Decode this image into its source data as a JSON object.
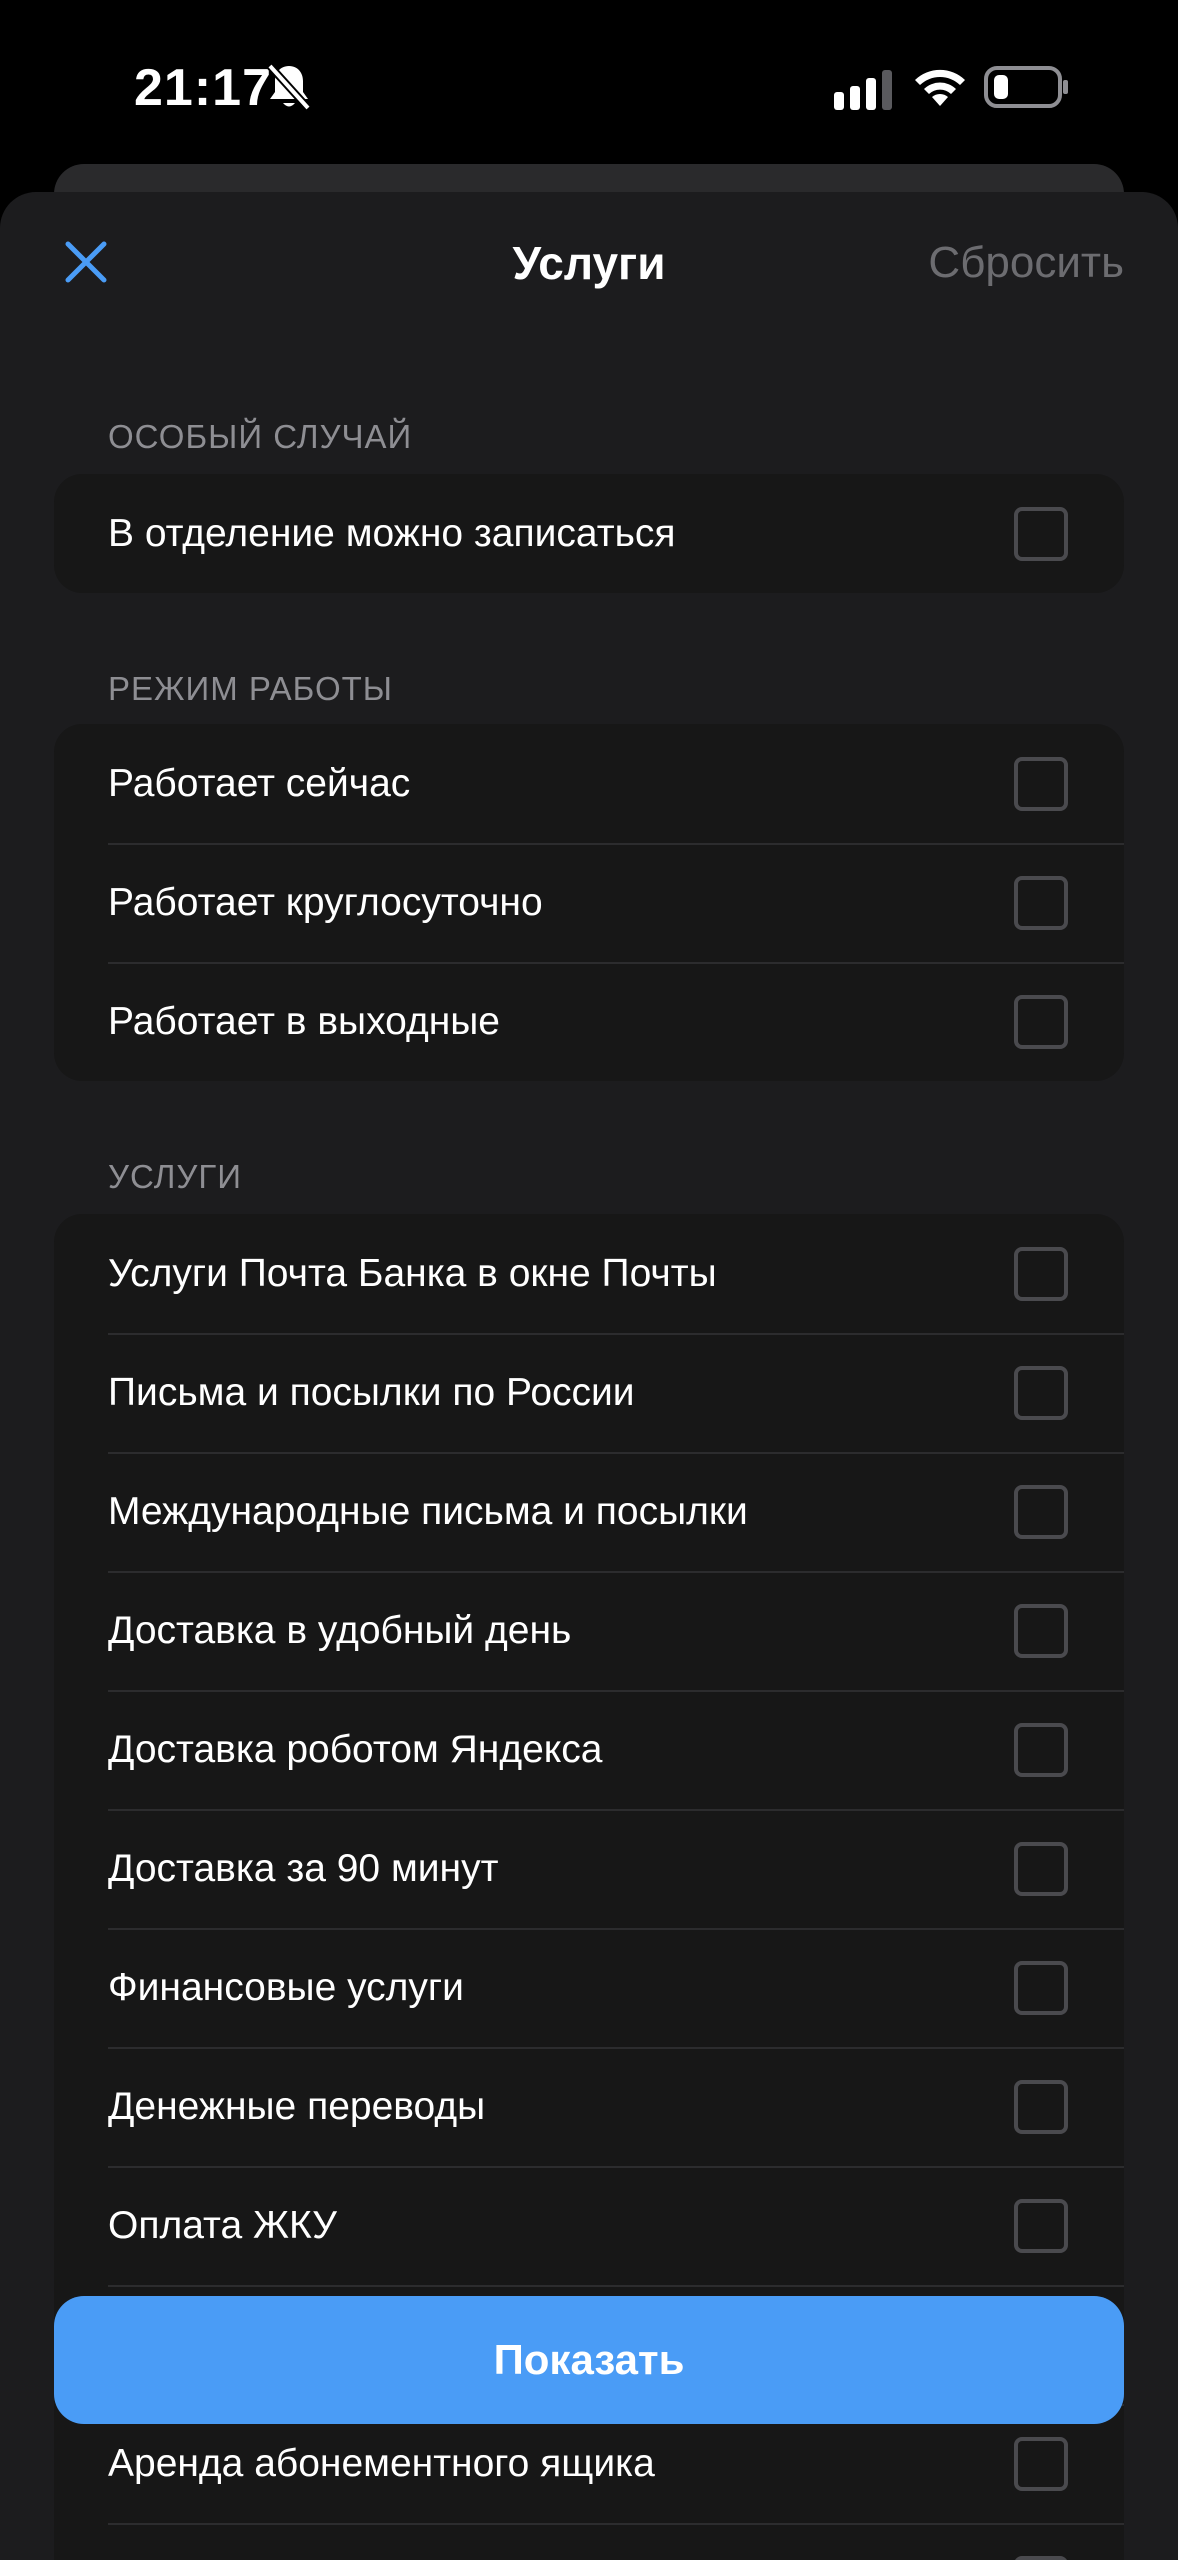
{
  "status_bar": {
    "time": "21:17"
  },
  "nav": {
    "title": "Услуги",
    "reset_label": "Сбросить",
    "close_icon": "close-icon"
  },
  "sections": [
    {
      "header": "ОСОБЫЙ СЛУЧАЙ",
      "items": [
        {
          "label": "В отделение можно записаться",
          "checked": false
        }
      ]
    },
    {
      "header": "РЕЖИМ РАБОТЫ",
      "items": [
        {
          "label": "Работает сейчас",
          "checked": false
        },
        {
          "label": "Работает круглосуточно",
          "checked": false
        },
        {
          "label": "Работает в выходные",
          "checked": false
        }
      ]
    },
    {
      "header": "УСЛУГИ",
      "items": [
        {
          "label": "Услуги Почта Банка в окне Почты",
          "checked": false
        },
        {
          "label": "Письма и посылки по России",
          "checked": false
        },
        {
          "label": "Международные письма и посылки",
          "checked": false
        },
        {
          "label": "Доставка в удобный день",
          "checked": false
        },
        {
          "label": "Доставка роботом Яндекса",
          "checked": false
        },
        {
          "label": "Доставка за 90 минут",
          "checked": false
        },
        {
          "label": "Финансовые услуги",
          "checked": false
        },
        {
          "label": "Денежные переводы",
          "checked": false
        },
        {
          "label": "Оплата ЖКУ",
          "checked": false
        },
        {
          "label": "",
          "checked": false
        },
        {
          "label": "Аренда абонементного ящика",
          "checked": false
        },
        {
          "label": "",
          "checked": false
        }
      ]
    }
  ],
  "show_button": {
    "label": "Показать"
  },
  "colors": {
    "accent": "#4a9cf6",
    "sheet_background": "#1c1c1e",
    "group_background": "#171717",
    "muted_text": "#8e8e93",
    "reset_text": "#6c6c70"
  }
}
